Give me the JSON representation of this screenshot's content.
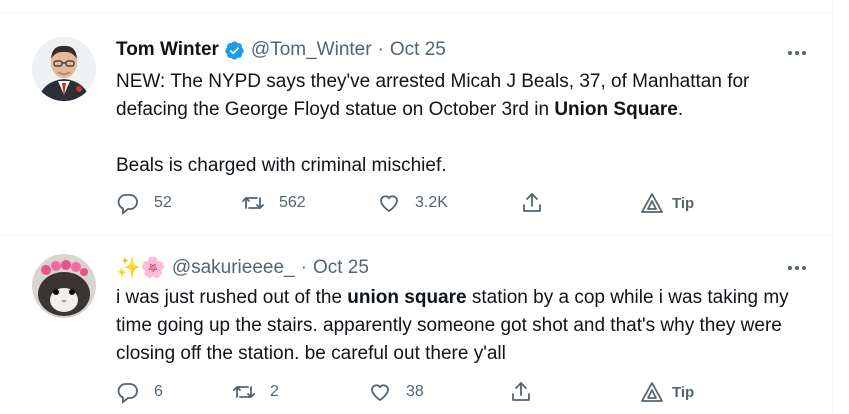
{
  "tweets": [
    {
      "name": "Tom Winter",
      "handle": "@Tom_Winter",
      "separator": "·",
      "date": "Oct 25",
      "verified": true,
      "avatar_icon": "avatar-photo",
      "text_p1_a": "NEW: The NYPD says they've arrested Micah J Beals, 37, of Manhattan for defacing the George Floyd statue on October 3rd in ",
      "text_p1_bold": "Union Square",
      "text_p1_b": ".",
      "text_p2": "Beals is charged with criminal mischief.",
      "replies": "52",
      "retweets": "562",
      "likes": "3.2K",
      "tip_label": "Tip"
    },
    {
      "name_emoji": "✨🌸",
      "handle": "@sakurieeee_",
      "separator": "·",
      "date": "Oct 25",
      "avatar_icon": "avatar-cat-photo",
      "text_a": "i was just rushed out of the ",
      "text_bold": "union square",
      "text_b": " station by a cop while i was taking my time going up the stairs. apparently someone got shot and that's why they were closing off the station. be careful out there y'all",
      "replies": "6",
      "retweets": "2",
      "likes": "38",
      "tip_label": "Tip"
    }
  ],
  "colors": {
    "text": "#0f1419",
    "secondary": "#536471",
    "verified": "#1d9bf0",
    "border": "#eff3f4"
  }
}
